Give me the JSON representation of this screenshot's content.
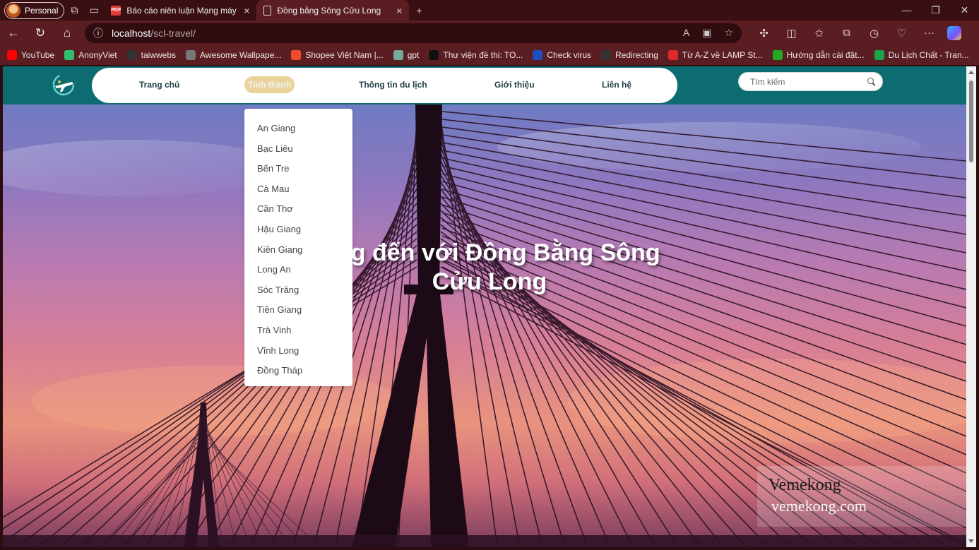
{
  "browser": {
    "profile_label": "Personal",
    "tabs": [
      {
        "title": "Báo cáo niên luận Mạng máy tính",
        "icon": "pdf-icon",
        "close": "×"
      },
      {
        "title": "Đồng bằng Sông Cửu Long",
        "icon": "page-icon",
        "close": "×",
        "active": true
      }
    ],
    "new_tab": "+",
    "address": {
      "host": "localhost",
      "path": "/scl-travel/"
    },
    "bookmarks": [
      {
        "label": "YouTube",
        "color": "#ff0000"
      },
      {
        "label": "AnonyViet",
        "color": "#2fbf71"
      },
      {
        "label": "taiwwebs",
        "color": "#333333"
      },
      {
        "label": "Awesome Wallpape...",
        "color": "#777777"
      },
      {
        "label": "Shopee Việt Nam |...",
        "color": "#ee4d2d"
      },
      {
        "label": "gpt",
        "color": "#74aa9c"
      },
      {
        "label": "Thư viện đề thi: TO...",
        "color": "#111111"
      },
      {
        "label": "Check virus",
        "color": "#1f4fbf"
      },
      {
        "label": "Redirecting",
        "color": "#333333"
      },
      {
        "label": "Từ A-Z về LAMP St...",
        "color": "#e02a2a"
      },
      {
        "label": "Hướng dẫn cài đặt...",
        "color": "#22aa22"
      },
      {
        "label": "Du Lịch Chất - Tran...",
        "color": "#1aa34a"
      }
    ]
  },
  "site": {
    "nav": [
      {
        "label": "Trang chủ"
      },
      {
        "label": "Tỉnh thành",
        "active": true
      },
      {
        "label": "Thông tin du lịch"
      },
      {
        "label": "Giới thiệu"
      },
      {
        "label": "Liên hệ"
      }
    ],
    "search": {
      "placeholder": "Tìm kiếm"
    },
    "provinces": [
      "An Giang",
      "Bạc Liêu",
      "Bến Tre",
      "Cà Mau",
      "Cần Thơ",
      "Hậu Giang",
      "Kiên Giang",
      "Long An",
      "Sóc Trăng",
      "Tiền Giang",
      "Trà Vinh",
      "Vĩnh Long",
      "Đồng Tháp"
    ],
    "hero": {
      "title_line1": "ững đến với Đồng Bằng Sông",
      "title_line2": "Cửu Long"
    },
    "watermark": {
      "brand": "Vemekong",
      "url": "vemekong.com"
    },
    "colors": {
      "header": "#0d6c71",
      "active_nav": "#e9d39a"
    }
  }
}
